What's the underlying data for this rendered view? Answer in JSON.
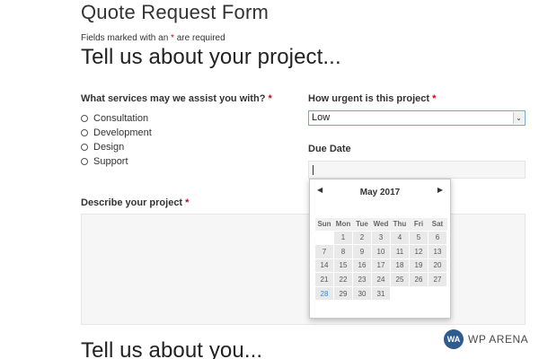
{
  "page": {
    "form_title": "Quote Request Form",
    "required_note_prefix": "Fields marked with an ",
    "required_note_star": "*",
    "required_note_suffix": " are required",
    "section1_title": "Tell us about your project...",
    "section2_title": "Tell us about you..."
  },
  "services": {
    "label": "What services may we assist you with?",
    "star": "*",
    "options": [
      "Consultation",
      "Development",
      "Design",
      "Support"
    ]
  },
  "urgency": {
    "label": "How urgent is this project",
    "star": "*",
    "value": "Low",
    "arrow": "⌄"
  },
  "due_date": {
    "label": "Due Date",
    "value": ""
  },
  "description": {
    "label": "Describe your project",
    "star": "*",
    "value": ""
  },
  "calendar": {
    "month_label": "May 2017",
    "prev_icon": "◀",
    "next_icon": "▶",
    "weekdays": [
      "Sun",
      "Mon",
      "Tue",
      "Wed",
      "Thu",
      "Fri",
      "Sat"
    ],
    "weeks": [
      [
        "",
        "1",
        "2",
        "3",
        "4",
        "5",
        "6"
      ],
      [
        "7",
        "8",
        "9",
        "10",
        "11",
        "12",
        "13"
      ],
      [
        "14",
        "15",
        "16",
        "17",
        "18",
        "19",
        "20"
      ],
      [
        "21",
        "22",
        "23",
        "24",
        "25",
        "26",
        "27"
      ],
      [
        "28",
        "29",
        "30",
        "31",
        "",
        "",
        ""
      ]
    ],
    "highlighted_day": "28",
    "highlight_color": "#2b8de0"
  },
  "brand": {
    "logo_text": "WA",
    "name": "WP ARENA",
    "color": "#2f5c8e"
  },
  "colors": {
    "required_star": "#d0021b",
    "select_border": "#7da2ce"
  }
}
